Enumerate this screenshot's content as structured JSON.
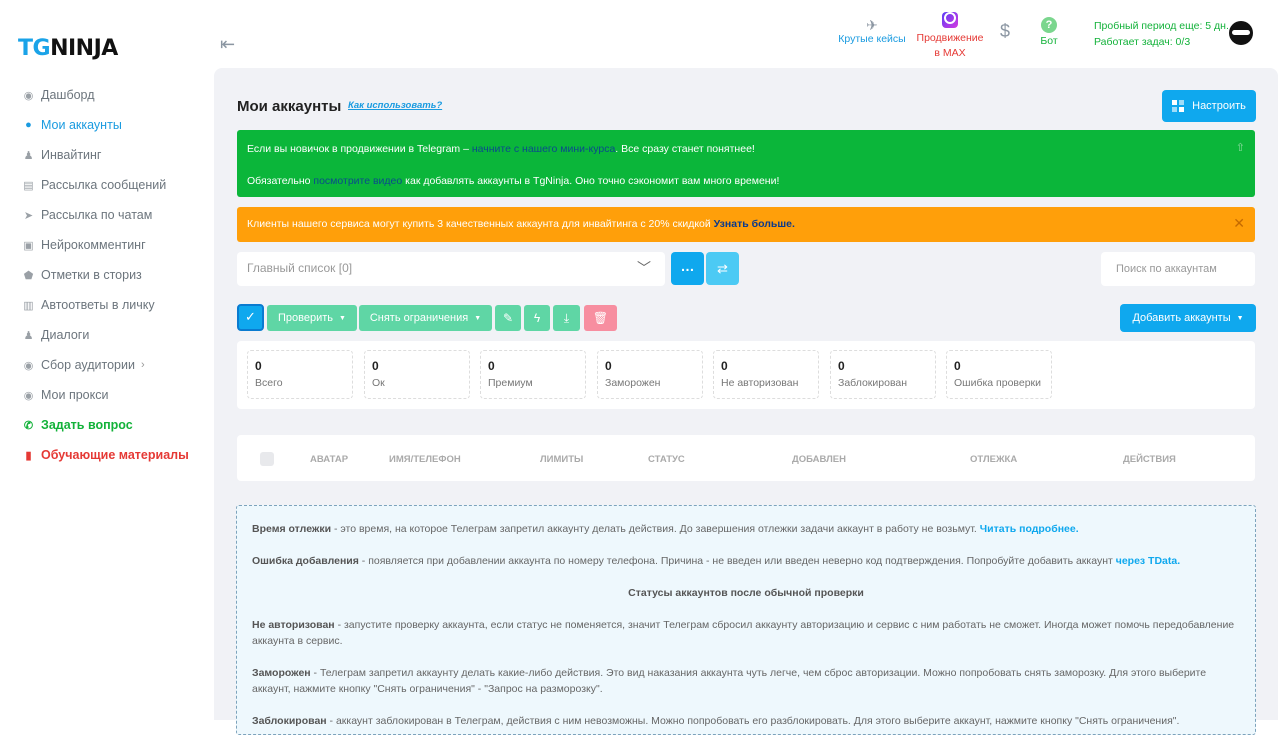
{
  "sidebar": {
    "logo": {
      "tg": "TG",
      "rest": "NINJA"
    },
    "items": [
      {
        "label": "Дашборд",
        "icon": "dashboard-icon",
        "glyph": "◉"
      },
      {
        "label": "Мои аккаунты",
        "icon": "user-icon",
        "glyph": "●"
      },
      {
        "label": "Инвайтинг",
        "icon": "invite-icon",
        "glyph": "♟"
      },
      {
        "label": "Рассылка сообщений",
        "icon": "messages-icon",
        "glyph": "▤"
      },
      {
        "label": "Рассылка по чатам",
        "icon": "send-icon",
        "glyph": "➤"
      },
      {
        "label": "Нейрокомментинг",
        "icon": "comment-icon",
        "glyph": "▣"
      },
      {
        "label": "Отметки в сториз",
        "icon": "shield-icon",
        "glyph": "⬟"
      },
      {
        "label": "Автоответы в личку",
        "icon": "autoreply-icon",
        "glyph": "▥"
      },
      {
        "label": "Диалоги",
        "icon": "dialogs-icon",
        "glyph": "♟"
      },
      {
        "label": "Сбор аудитории",
        "icon": "audience-icon",
        "glyph": "◉"
      },
      {
        "label": "Мои прокси",
        "icon": "proxy-icon",
        "glyph": "◉"
      },
      {
        "label": "Задать вопрос",
        "icon": "whatsapp-icon",
        "glyph": "✆"
      },
      {
        "label": "Обучающие материалы",
        "icon": "book-icon",
        "glyph": "▮"
      }
    ]
  },
  "topbar": {
    "cases": "Крутые кейсы",
    "max": "Продвижение в MAX",
    "dollar": "$",
    "bot": "Бот",
    "bot_glyph": "?",
    "trial": "Пробный период еще: 5 дн.",
    "tasks": "Работает задач: 0/3",
    "collapse": "⇤"
  },
  "page": {
    "title": "Мои аккаунты",
    "help_link": "Как использовать?",
    "setup_button": "Настроить"
  },
  "alerts": {
    "green": {
      "line1_pre": "Если вы новичок в продвижении в Telegram – ",
      "line1_link": "начните с нашего мини-курса",
      "line1_post": ". Все сразу станет понятнее!",
      "line2_pre": "Обязательно ",
      "line2_link": "посмотрите видео",
      "line2_post": " как добавлять аккаунты в TgNinja. Оно точно сэкономит вам много времени!"
    },
    "orange": {
      "text": "Клиенты нашего сервиса могут купить 3 качественных аккаунта для инвайтинга с 20% скидкой ",
      "link": "Узнать больше."
    }
  },
  "list_select": {
    "value": "Главный список [0]"
  },
  "search": {
    "placeholder": "Поиск по аккаунтам"
  },
  "toolbar": {
    "check": "Проверить",
    "unrestrict": "Снять ограничения",
    "add": "Добавить аккаунты"
  },
  "stats": [
    {
      "value": "0",
      "label": "Всего"
    },
    {
      "value": "0",
      "label": "Ок"
    },
    {
      "value": "0",
      "label": "Премиум"
    },
    {
      "value": "0",
      "label": "Заморожен"
    },
    {
      "value": "0",
      "label": "Не авторизован"
    },
    {
      "value": "0",
      "label": "Заблокирован"
    },
    {
      "value": "0",
      "label": "Ошибка проверки"
    }
  ],
  "table": {
    "columns": [
      "АВАТАР",
      "ИМЯ/ТЕЛЕФОН",
      "ЛИМИТЫ",
      "СТАТУС",
      "ДОБАВЛЕН",
      "ОТЛЕЖКА",
      "ДЕЙСТВИЯ"
    ]
  },
  "info": {
    "p1_bold": "Время отлежки",
    "p1_text": " - это время, на которое Телеграм запретил аккаунту делать действия. До завершения отлежки задачи аккаунт в работу не возьмут. ",
    "p1_link": "Читать подробнее.",
    "p2_bold": "Ошибка добавления",
    "p2_text": " - появляется при добавлении аккаунта по номеру телефона. Причина - не введен или введен неверно код подтверждения. Попробуйте добавить аккаунт ",
    "p2_link": "через TData.",
    "heading": "Статусы аккаунтов после обычной проверки",
    "p3_bold": "Не авторизован",
    "p3_text": " - запустите проверку аккаунта, если статус не поменяется, значит Телеграм сбросил аккаунту авторизацию и сервис с ним работать не сможет. Иногда может помочь передобавление аккаунта в сервис.",
    "p4_bold": "Заморожен",
    "p4_text": " - Телеграм запретил аккаунту делать какие-либо действия. Это вид наказания аккаунта чуть легче, чем сброс авторизации. Можно попробовать снять заморозку. Для этого выберите аккаунт, нажмите кнопку \"Снять ограничения\" - \"Запрос на разморозку\".",
    "p5_bold": "Заблокирован",
    "p5_text": " - аккаунт заблокирован в Телеграм, действия с ним невозможны. Можно попробовать его разблокировать. Для этого выберите аккаунт, нажмите кнопку \"Снять ограничения\"."
  },
  "colors": {
    "accent": "#0fa8ee",
    "success": "#0bb63a",
    "warning": "#ff9f0a",
    "danger": "#e53935"
  }
}
